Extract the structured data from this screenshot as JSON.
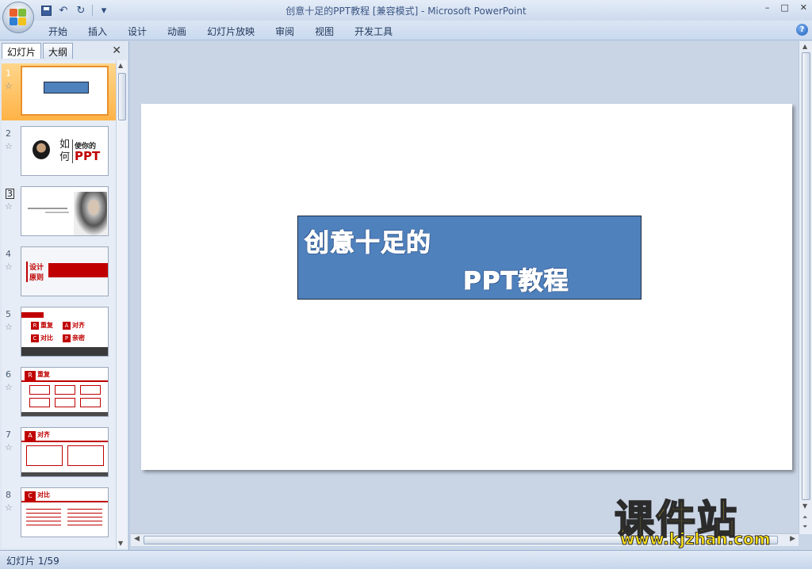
{
  "window": {
    "title": "创意十足的PPT教程 [兼容模式] - Microsoft PowerPoint",
    "controls": [
      "–",
      "□",
      "✕"
    ]
  },
  "qat": {
    "save_icon": "save-icon",
    "undo_icon": "↶",
    "redo_icon": "↻",
    "customize_icon": "▾"
  },
  "ribbon": {
    "tabs": [
      "开始",
      "插入",
      "设计",
      "动画",
      "幻灯片放映",
      "审阅",
      "视图",
      "开发工具"
    ],
    "help_icon": "?"
  },
  "left_pane": {
    "tab_slides": "幻灯片",
    "tab_outline": "大纲",
    "close": "✕",
    "thumbnails": [
      {
        "num": "1",
        "active": true
      },
      {
        "num": "2"
      },
      {
        "num": "3"
      },
      {
        "num": "4"
      },
      {
        "num": "5"
      },
      {
        "num": "6"
      },
      {
        "num": "7"
      },
      {
        "num": "8"
      }
    ],
    "thumb2": {
      "line_a": "如",
      "line_b": "何",
      "line_c": "使你的",
      "line_d": "PPT"
    },
    "thumb4": {
      "label_a": "设计",
      "label_b": "原则"
    },
    "thumb5": {
      "r": "R",
      "r_label": "重复",
      "a": "A",
      "a_label": "对齐",
      "c": "C",
      "c_label": "对比",
      "p": "P",
      "p_label": "亲密"
    },
    "thumb6": {
      "r": "R",
      "r_label": "重复"
    },
    "thumb7": {
      "a": "A",
      "a_label": "对齐"
    },
    "thumb8": {
      "c": "C",
      "c_label": "对比"
    },
    "star_icon": "☆"
  },
  "slide": {
    "title_line1": "创意十足的",
    "title_line2": "PPT教程",
    "box_color": "#4f81bd"
  },
  "status": {
    "text": "幻灯片 1/59"
  },
  "watermark": {
    "big": "课件站",
    "small": "www.kjzhan.com"
  }
}
